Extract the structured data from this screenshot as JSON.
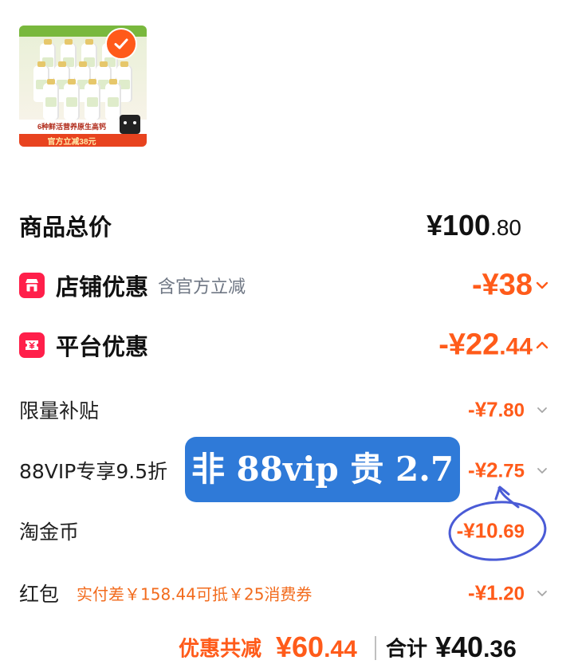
{
  "product": {
    "badge_line": "6种鲜活营养原生高钙",
    "promo_band": "官方立减38元",
    "selected": true
  },
  "summary": {
    "total_price": {
      "label": "商品总价",
      "yuan": "¥100",
      "cents": ".80"
    },
    "store_discount": {
      "label": "店铺优惠",
      "note": "含官方立减",
      "yuan": "-¥38",
      "cents": "",
      "icon": "store-icon",
      "chevron": "down"
    },
    "platform_discount": {
      "label": "平台优惠",
      "yuan": "-¥22",
      "cents": ".44",
      "icon": "coupon-icon",
      "chevron": "up"
    }
  },
  "details": [
    {
      "label": "限量补贴",
      "note": "",
      "yuan": "-¥7",
      "cents": ".80"
    },
    {
      "label": "88VIP专享9.5折",
      "note": "",
      "yuan": "-¥2",
      "cents": ".75"
    },
    {
      "label": "淘金币",
      "note": "",
      "yuan": "-¥10",
      "cents": ".69"
    },
    {
      "label": "红包",
      "note": "实付差￥158.44可抵￥25消费券",
      "yuan": "-¥1",
      "cents": ".20"
    }
  ],
  "annotation": {
    "text": "非 88vip 贵 2.7"
  },
  "footer": {
    "discount_label": "优惠共减",
    "discount_yuan": "¥60",
    "discount_cents": ".44",
    "total_label": "合计",
    "total_yuan": "¥40",
    "total_cents": ".36"
  },
  "colors": {
    "accent_orange": "#ff5b1a",
    "icon_red": "#ff1f4a",
    "callout_blue": "#2f7ad8",
    "scribble_blue": "#4a5bd6"
  }
}
